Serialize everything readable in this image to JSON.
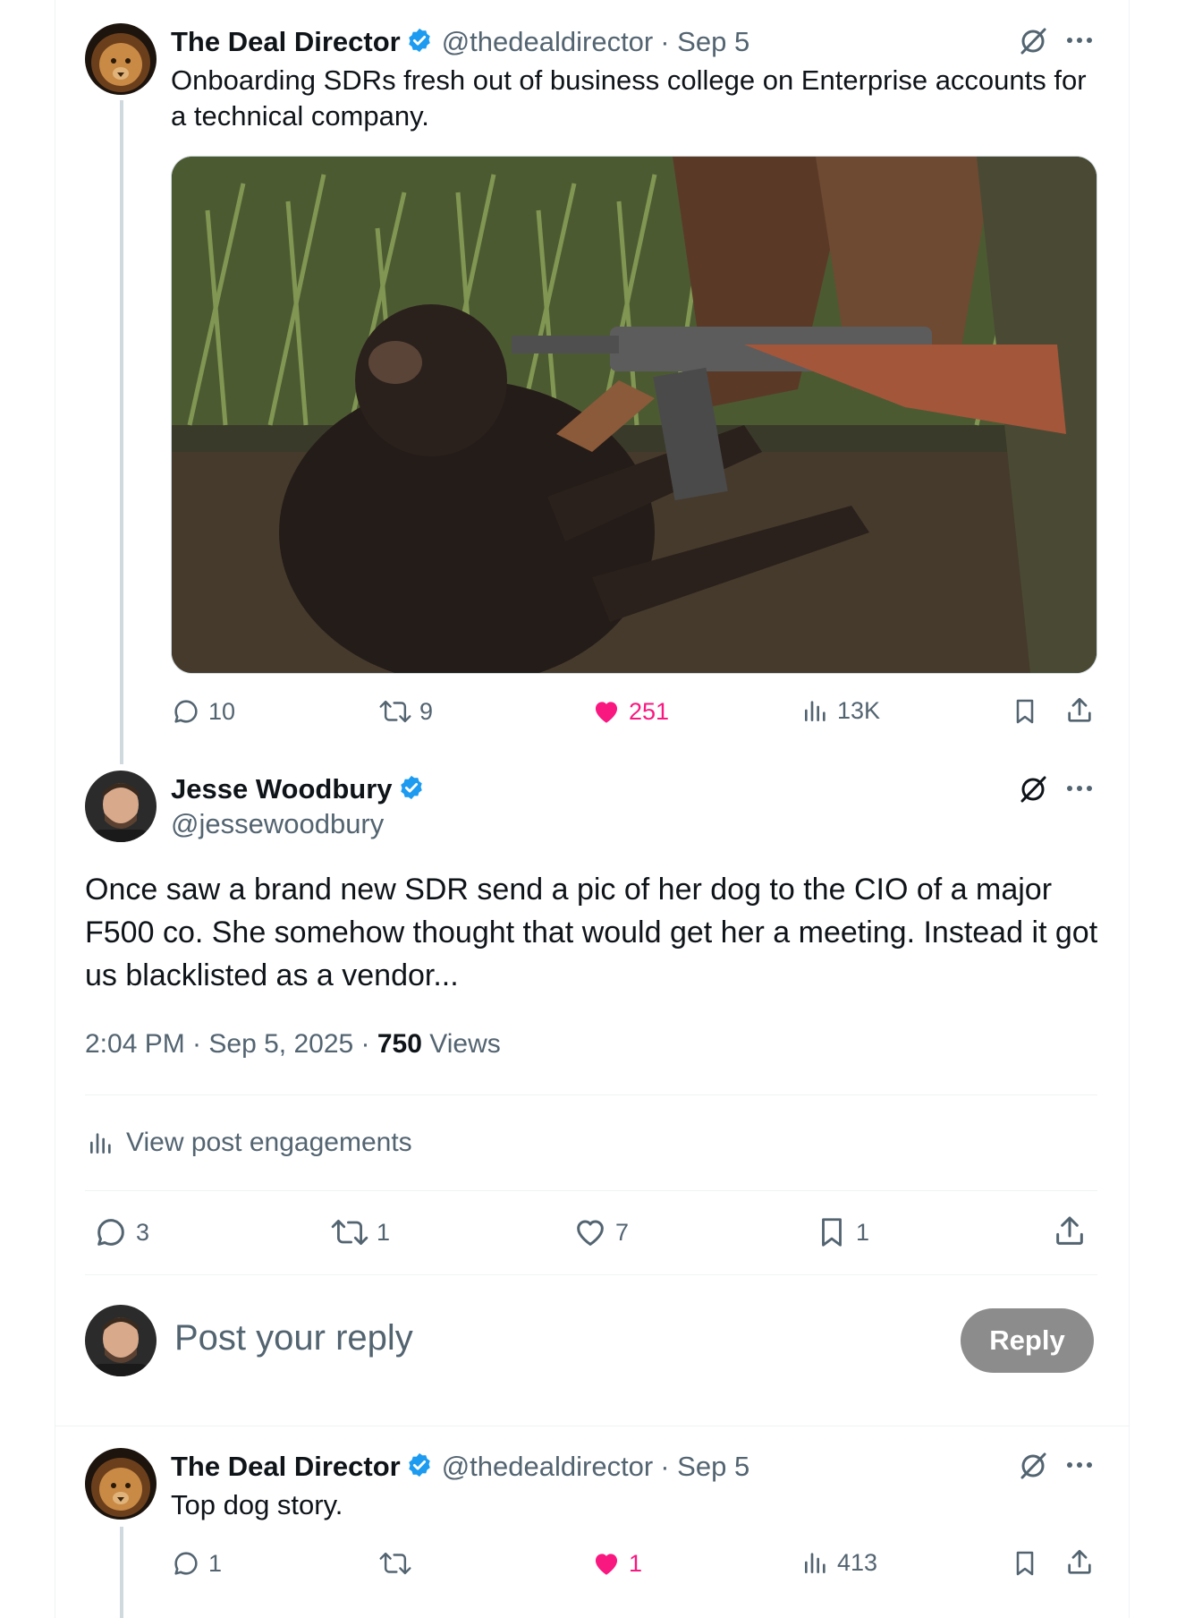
{
  "post1": {
    "name": "The Deal Director",
    "handle": "@thedealdirector",
    "date": "· Sep 5",
    "text": "Onboarding SDRs fresh out of business college on Enterprise accounts for a technical company.",
    "image_alt": "chimpanzee reaching for a rifle",
    "replies": "10",
    "reposts": "9",
    "likes": "251",
    "views": "13K"
  },
  "post2": {
    "name": "Jesse Woodbury",
    "handle": "@jessewoodbury",
    "text": "Once saw a brand new SDR send a pic of her dog to the CIO of a major F500 co. She somehow thought that would get her a meeting. Instead it got us blacklisted as a vendor...",
    "time": "2:04 PM · Sep 5, 2025 · ",
    "views_count": "750",
    "views_label": " Views",
    "engagements": "View post engagements",
    "replies": "3",
    "reposts": "1",
    "likes": "7",
    "bookmarks": "1"
  },
  "composer": {
    "placeholder": "Post your reply",
    "button": "Reply"
  },
  "post3": {
    "name": "The Deal Director",
    "handle": "@thedealdirector",
    "date": "· Sep 5",
    "text": "Top dog story.",
    "replies": "1",
    "likes": "1",
    "views": "413"
  },
  "colors": {
    "accent": "#1d9bf0",
    "like": "#f91880",
    "muted": "#536471"
  }
}
